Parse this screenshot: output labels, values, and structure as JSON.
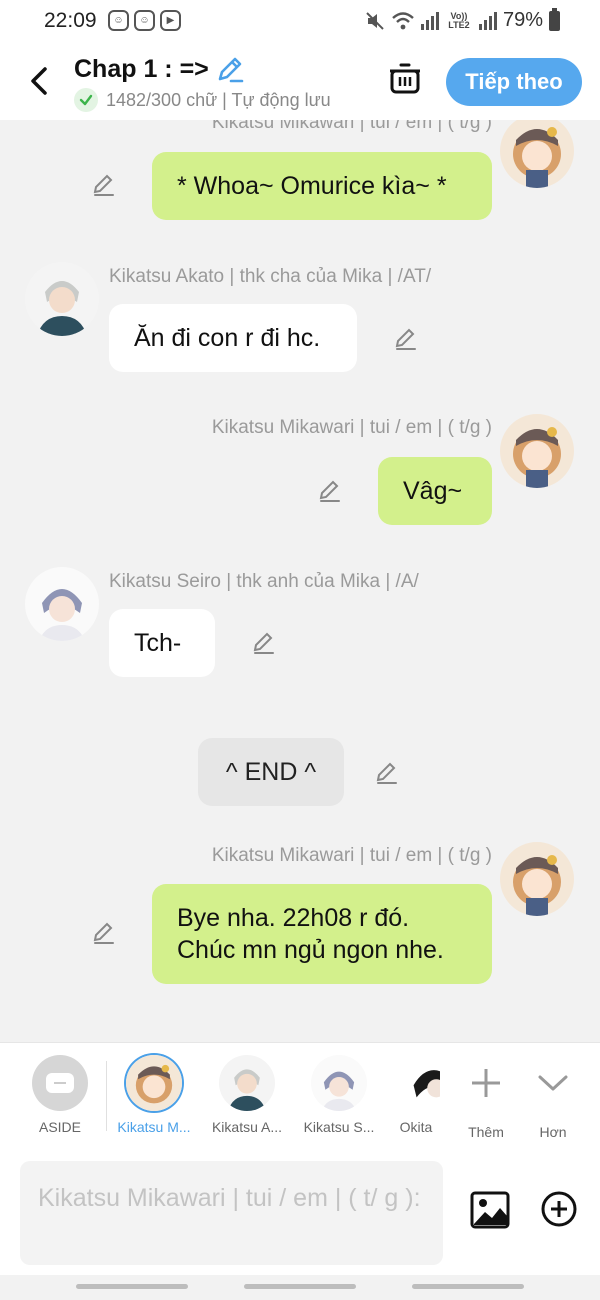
{
  "status_bar": {
    "time": "22:09",
    "battery": "79%",
    "volte": "Vo)) LTE2"
  },
  "header": {
    "title": "Chap 1 : =>",
    "word_count": "1482/300 chữ | Tự động lưu",
    "next_label": "Tiếp theo"
  },
  "messages": [
    {
      "speaker": "Kikatsu Mikawari | tui / em | ( t/g )",
      "text": "* Whoa~ Omurice kìa~ *"
    },
    {
      "speaker": "Kikatsu Akato | thk cha của Mika | /AT/",
      "text": "Ăn đi con r đi hc."
    },
    {
      "speaker": "Kikatsu Mikawari | tui / em | ( t/g )",
      "text": "Vâg~"
    },
    {
      "speaker": "Kikatsu Seiro | thk anh của Mika | /A/",
      "text": "Tch-"
    },
    {
      "speaker": "",
      "text": "^ END ^"
    },
    {
      "speaker": "Kikatsu Mikawari | tui / em | ( t/g )",
      "text_line1": "Bye nha. 22h08 r đó.",
      "text_line2": "Chúc mn ngủ ngon nhe."
    }
  ],
  "characters": [
    {
      "label": "ASIDE"
    },
    {
      "label": "Kikatsu M..."
    },
    {
      "label": "Kikatsu A..."
    },
    {
      "label": "Kikatsu S..."
    },
    {
      "label": "Okita"
    },
    {
      "label": "Thêm"
    },
    {
      "label": "Hơn"
    }
  ],
  "input": {
    "placeholder": "Kikatsu Mikawari | tui / em | ( t/ g ):"
  },
  "colors": {
    "accent": "#56a8ee",
    "my_bubble": "#d3f08c",
    "other_bubble": "#ffffff"
  }
}
